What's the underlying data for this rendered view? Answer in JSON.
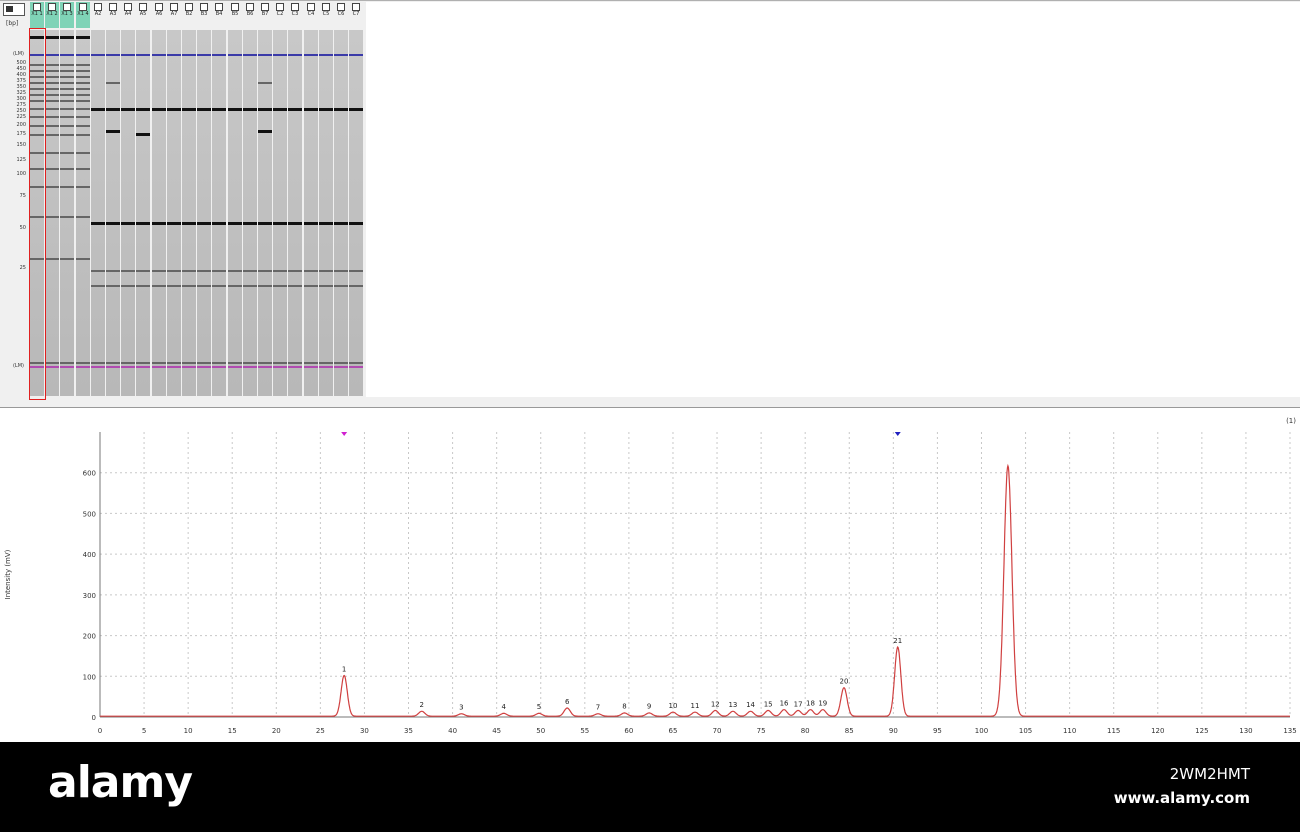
{
  "gel": {
    "bp_unit": "[bp]",
    "marker_label": "(LM)",
    "size_labels": [
      "500",
      "450",
      "400",
      "375",
      "350",
      "325",
      "300",
      "275",
      "250",
      "225",
      "200",
      "175",
      "150",
      "125",
      "100",
      "75",
      "50",
      "25"
    ],
    "lanes": [
      {
        "id": "X1 1",
        "ladder": true
      },
      {
        "id": "X1 2",
        "ladder": true
      },
      {
        "id": "X1 3",
        "ladder": true
      },
      {
        "id": "X1 4",
        "ladder": true
      },
      {
        "id": "A2",
        "ladder": false
      },
      {
        "id": "A3",
        "ladder": false
      },
      {
        "id": "A4",
        "ladder": false
      },
      {
        "id": "A5",
        "ladder": false
      },
      {
        "id": "A6",
        "ladder": false
      },
      {
        "id": "A7",
        "ladder": false
      },
      {
        "id": "B2",
        "ladder": false
      },
      {
        "id": "B3",
        "ladder": false
      },
      {
        "id": "B4",
        "ladder": false
      },
      {
        "id": "B5",
        "ladder": false
      },
      {
        "id": "B6",
        "ladder": false
      },
      {
        "id": "B7",
        "ladder": false
      },
      {
        "id": "C2",
        "ladder": false
      },
      {
        "id": "C3",
        "ladder": false
      },
      {
        "id": "C4",
        "ladder": false
      },
      {
        "id": "C5",
        "ladder": false
      },
      {
        "id": "C6",
        "ladder": false
      },
      {
        "id": "C7",
        "ladder": false
      }
    ]
  },
  "electropherogram": {
    "corner_label": "(1)",
    "chart_data": {
      "type": "line",
      "ylabel": "Intensity (mV)",
      "xlim": [
        0,
        135
      ],
      "ylim": [
        0,
        700
      ],
      "xticks": [
        0,
        5,
        10,
        15,
        20,
        25,
        30,
        35,
        40,
        45,
        50,
        55,
        60,
        65,
        70,
        75,
        80,
        85,
        90,
        95,
        100,
        105,
        110,
        115,
        120,
        125,
        130,
        135
      ],
      "yticks": [
        0,
        100,
        200,
        300,
        400,
        500,
        600
      ],
      "grid": true,
      "series_color": "#d04040",
      "peaks": [
        {
          "label": "1",
          "x": 27.7,
          "y": 100
        },
        {
          "label": "2",
          "x": 36.5,
          "y": 12
        },
        {
          "label": "3",
          "x": 41,
          "y": 6
        },
        {
          "label": "4",
          "x": 45.8,
          "y": 7
        },
        {
          "label": "5",
          "x": 49.8,
          "y": 7
        },
        {
          "label": "6",
          "x": 53,
          "y": 20
        },
        {
          "label": "7",
          "x": 56.5,
          "y": 6
        },
        {
          "label": "8",
          "x": 59.5,
          "y": 8
        },
        {
          "label": "9",
          "x": 62.3,
          "y": 8
        },
        {
          "label": "10",
          "x": 65,
          "y": 10
        },
        {
          "label": "11",
          "x": 67.5,
          "y": 10
        },
        {
          "label": "12",
          "x": 69.8,
          "y": 14
        },
        {
          "label": "13",
          "x": 71.8,
          "y": 12
        },
        {
          "label": "14",
          "x": 73.8,
          "y": 12
        },
        {
          "label": "15",
          "x": 75.8,
          "y": 14
        },
        {
          "label": "16",
          "x": 77.6,
          "y": 16
        },
        {
          "label": "17",
          "x": 79.2,
          "y": 14
        },
        {
          "label": "18",
          "x": 80.6,
          "y": 16
        },
        {
          "label": "19",
          "x": 82,
          "y": 16
        },
        {
          "label": "20",
          "x": 84.4,
          "y": 70
        },
        {
          "label": "21",
          "x": 90.5,
          "y": 170
        },
        {
          "label": "",
          "x": 103,
          "y": 615
        }
      ],
      "markers": [
        {
          "x": 27.7,
          "color": "#d020d0"
        },
        {
          "x": 90.5,
          "color": "#2020c0"
        }
      ]
    }
  },
  "watermark": {
    "brand": "alamy",
    "code": "2WM2HMT",
    "url": "www.alamy.com"
  }
}
